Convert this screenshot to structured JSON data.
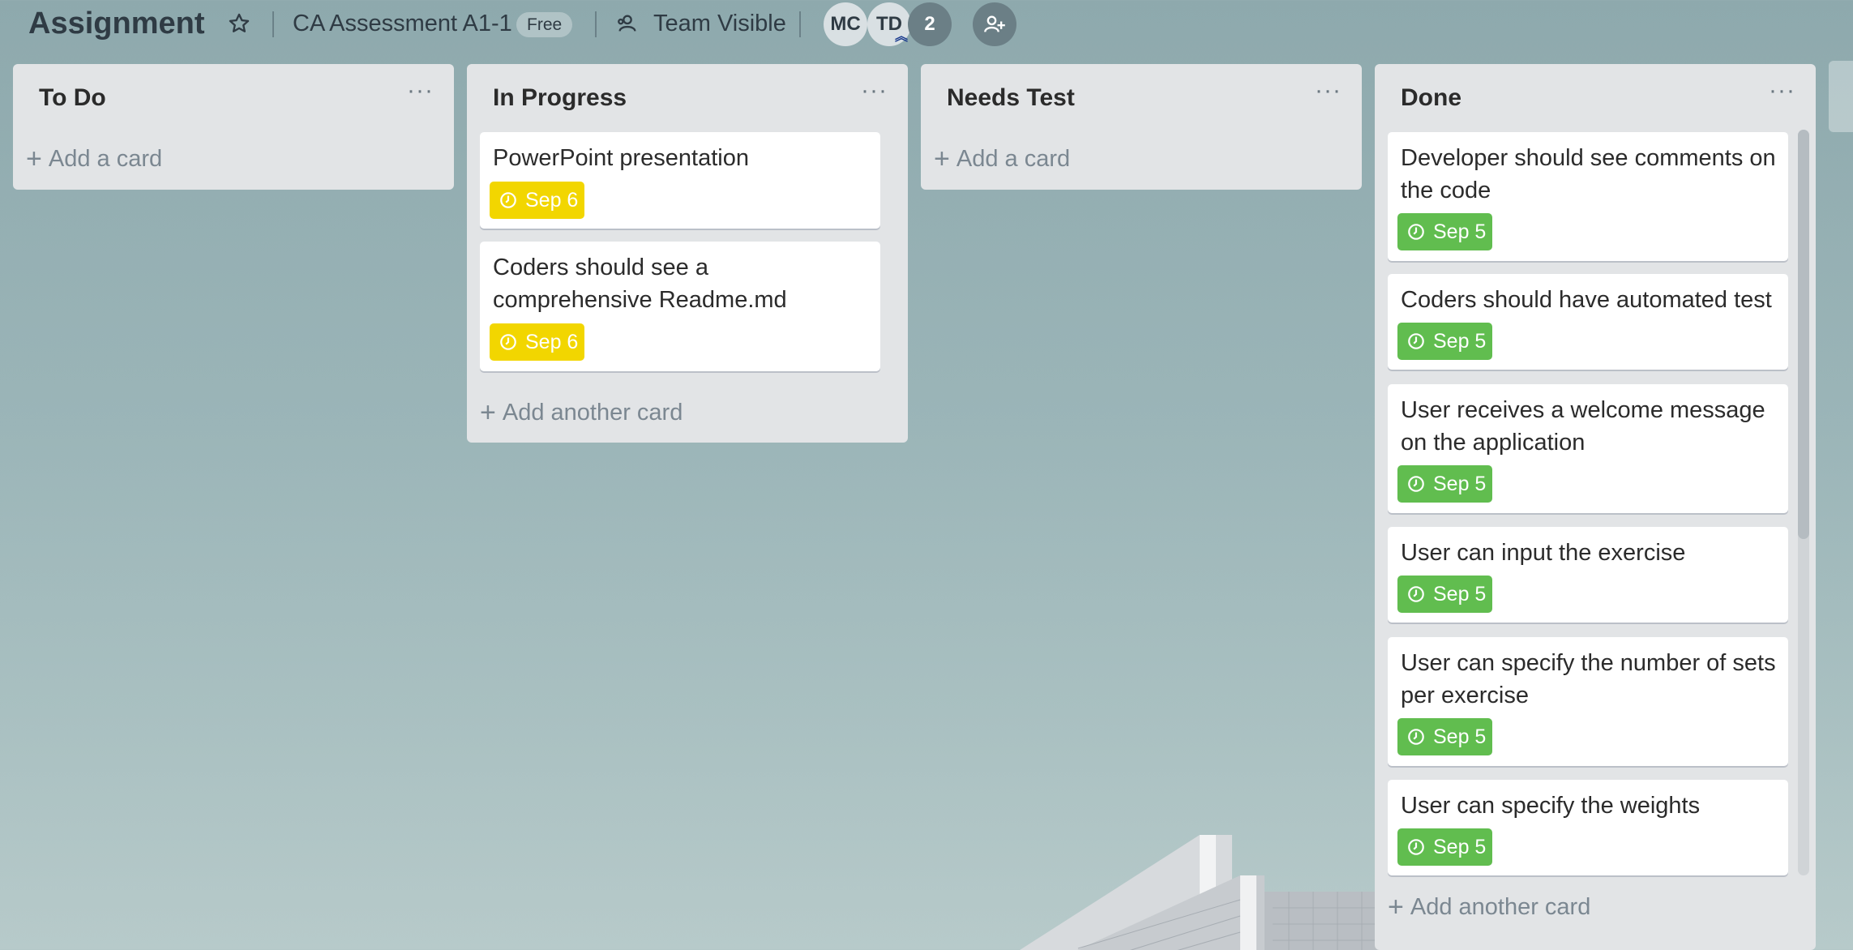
{
  "header": {
    "board_title": "Assignment",
    "team_name": "CA Assessment A1-1",
    "plan_badge": "Free",
    "visibility": "Team Visible",
    "members": [
      "MC",
      "TD"
    ],
    "extra_members": "2"
  },
  "lists": [
    {
      "title": "To Do",
      "menu": "···",
      "add_label": "Add a card",
      "cards": []
    },
    {
      "title": "In Progress",
      "menu": "···",
      "add_label": "Add another card",
      "cards": [
        {
          "title": "PowerPoint presentation",
          "due": "Sep 6",
          "color": "#f2d600"
        },
        {
          "title": "Coders should see a comprehensive Readme.md",
          "due": "Sep 6",
          "color": "#f2d600"
        }
      ]
    },
    {
      "title": "Needs Test",
      "menu": "···",
      "add_label": "Add a card",
      "cards": []
    },
    {
      "title": "Done",
      "menu": "···",
      "add_label": "Add another card",
      "cards": [
        {
          "title": "Developer should see comments on the code",
          "due": "Sep 5",
          "color": "#61bd4f"
        },
        {
          "title": "Coders should have automated test",
          "due": "Sep 5",
          "color": "#61bd4f"
        },
        {
          "title": "User receives a welcome message on the application",
          "due": "Sep 5",
          "color": "#61bd4f"
        },
        {
          "title": "User can input the exercise",
          "due": "Sep 5",
          "color": "#61bd4f"
        },
        {
          "title": "User can specify the number of sets per exercise",
          "due": "Sep 5",
          "color": "#61bd4f"
        },
        {
          "title": "User can specify the weights",
          "due": "Sep 5",
          "color": "#61bd4f"
        }
      ]
    }
  ],
  "icons": {
    "star": "star-icon",
    "visibility": "team-icon",
    "clock": "clock-icon",
    "add_member": "add-member-icon",
    "plus": "plus-icon"
  }
}
